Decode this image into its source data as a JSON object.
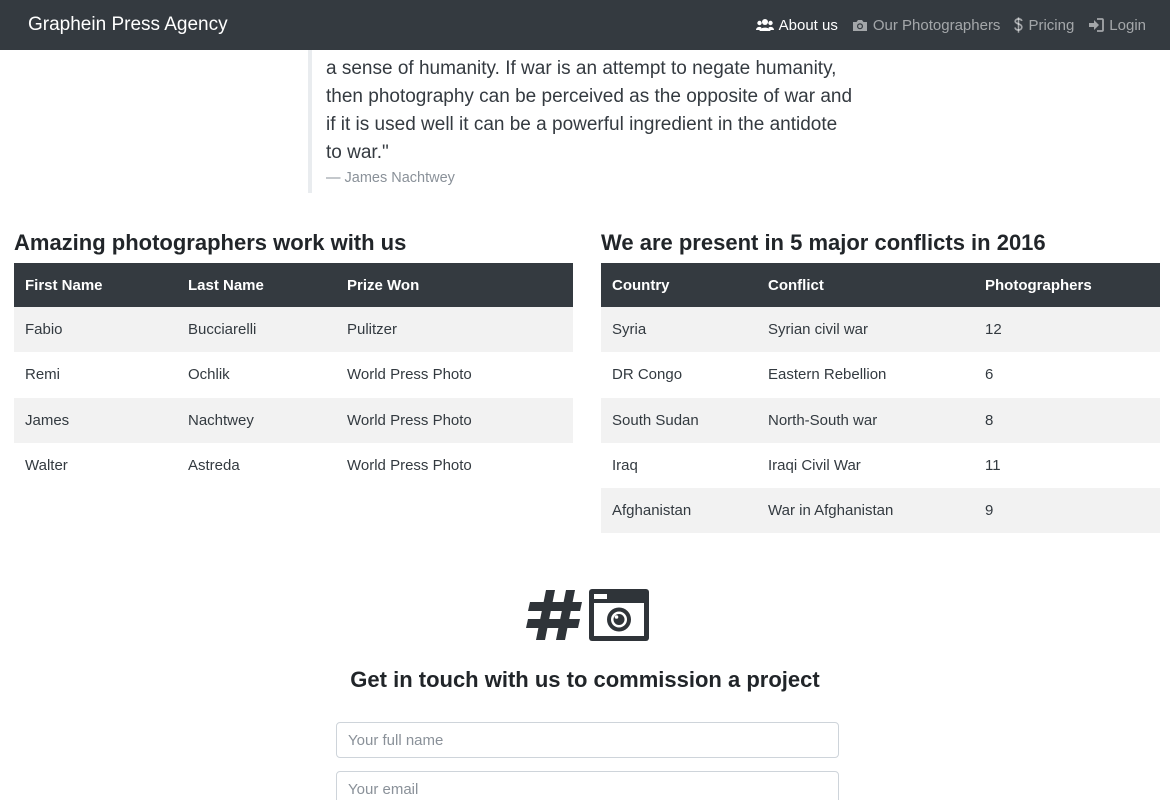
{
  "navbar": {
    "brand": "Graphein Press Agency",
    "links": [
      {
        "label": "About us",
        "icon": "users-icon",
        "active": true
      },
      {
        "label": "Our Photographers",
        "icon": "camera-icon",
        "active": false
      },
      {
        "label": "Pricing",
        "icon": "dollar-icon",
        "active": false
      },
      {
        "label": "Login",
        "icon": "login-icon",
        "active": false
      }
    ]
  },
  "quote": {
    "lines": [
      "a sense of humanity. If war is an attempt to negate humanity,",
      "then photography can be perceived as the opposite of war and",
      "if it is used well it can be a powerful ingredient in the antidote",
      "to war.\""
    ],
    "author": "— James Nachtwey"
  },
  "photographers": {
    "title": "Amazing photographers work with us",
    "headers": [
      "First Name",
      "Last Name",
      "Prize Won"
    ],
    "rows": [
      [
        "Fabio",
        "Bucciarelli",
        "Pulitzer"
      ],
      [
        "Remi",
        "Ochlik",
        "World Press Photo"
      ],
      [
        "James",
        "Nachtwey",
        "World Press Photo"
      ],
      [
        "Walter",
        "Astreda",
        "World Press Photo"
      ]
    ]
  },
  "conflicts": {
    "title": "We are present in 5 major conflicts in 2016",
    "headers": [
      "Country",
      "Conflict",
      "Photographers"
    ],
    "rows": [
      [
        "Syria",
        "Syrian civil war",
        "12"
      ],
      [
        "DR Congo",
        "Eastern Rebellion",
        "6"
      ],
      [
        "South Sudan",
        "North-South war",
        "8"
      ],
      [
        "Iraq",
        "Iraqi Civil War",
        "11"
      ],
      [
        "Afghanistan",
        "War in Afghanistan",
        "9"
      ]
    ]
  },
  "contact": {
    "title": "Get in touch with us to commission a project",
    "name_placeholder": "Your full name",
    "email_placeholder": "Your email",
    "icons": [
      "hashtag-icon",
      "camera-icon"
    ]
  },
  "colors": {
    "navbar_bg": "#343a40",
    "table_header_bg": "#343a40",
    "striped_row_bg": "#f2f2f2"
  }
}
